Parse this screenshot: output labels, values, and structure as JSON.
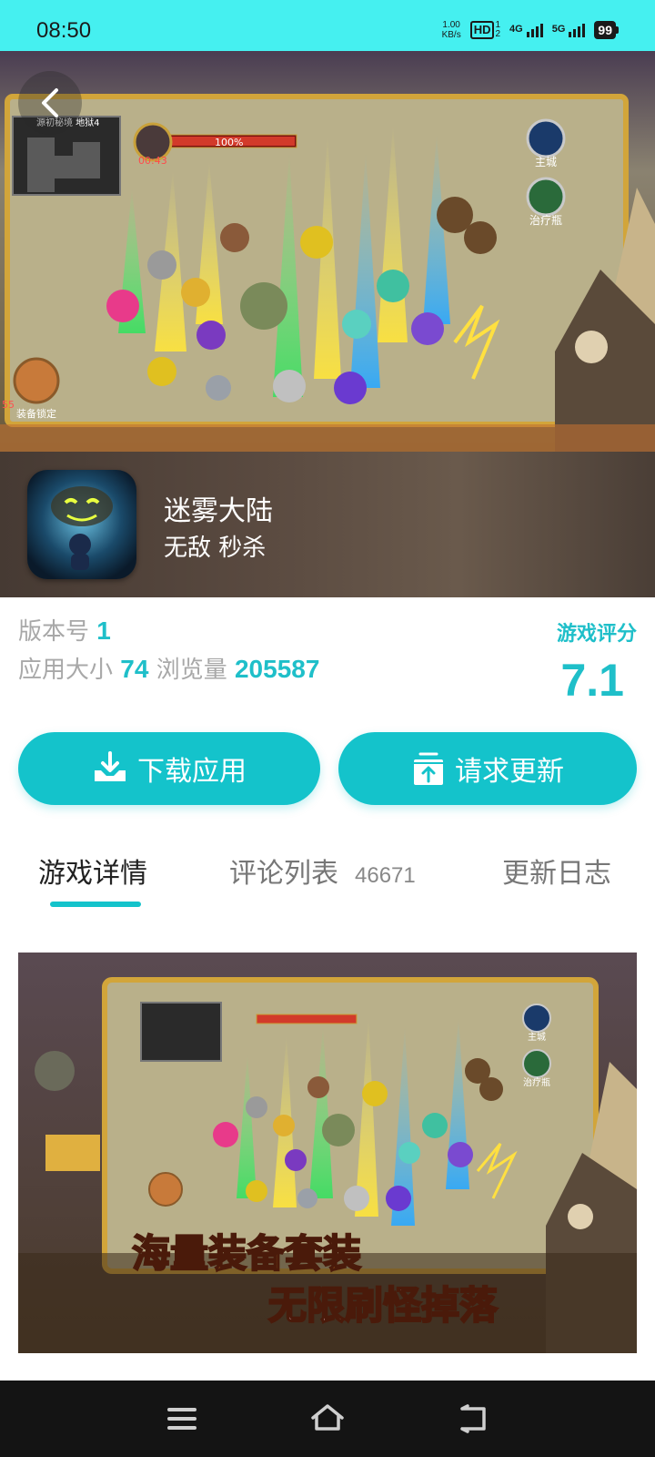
{
  "status_bar": {
    "time": "08:50",
    "net_speed_value": "1.00",
    "net_speed_unit": "KB/s",
    "hd_label": "HD",
    "hd_sub": "1",
    "hd_sub2": "2",
    "signal1_label": "4G",
    "signal2_label": "5G",
    "battery": "99"
  },
  "hero": {
    "app_name": "迷雾大陆",
    "app_tags": "无敌 秒杀",
    "art_labels": {
      "map_title": "源初秘境 地狱4",
      "boss_timer": "00:43",
      "boss_hp": "100%",
      "main_city": "主城",
      "potion": "治疗瓶",
      "equip_lock": "装备锁定",
      "level": "55"
    }
  },
  "info": {
    "version_label": "版本号",
    "version_value": "1",
    "size_label": "应用大小",
    "size_value": "74",
    "views_label": "浏览量",
    "views_value": "205587",
    "rating_label": "游戏评分",
    "rating_value": "7.1"
  },
  "buttons": {
    "download": "下载应用",
    "update": "请求更新"
  },
  "tabs": {
    "details": "游戏详情",
    "comments": "评论列表",
    "comments_count": "46671",
    "changelog": "更新日志",
    "active": "details"
  },
  "screenshot": {
    "banner_line1": "海量装备套装",
    "banner_line2": "无限刷怪掉落",
    "main_city": "主城",
    "potion": "治疗瓶"
  },
  "colors": {
    "accent": "#14c3cb",
    "status_bar": "#45f0f0",
    "nav_bar": "#141414"
  },
  "icons": [
    "back-arrow-icon",
    "download-tray-icon",
    "upload-box-icon",
    "menu-lines-icon",
    "home-icon",
    "return-icon"
  ]
}
